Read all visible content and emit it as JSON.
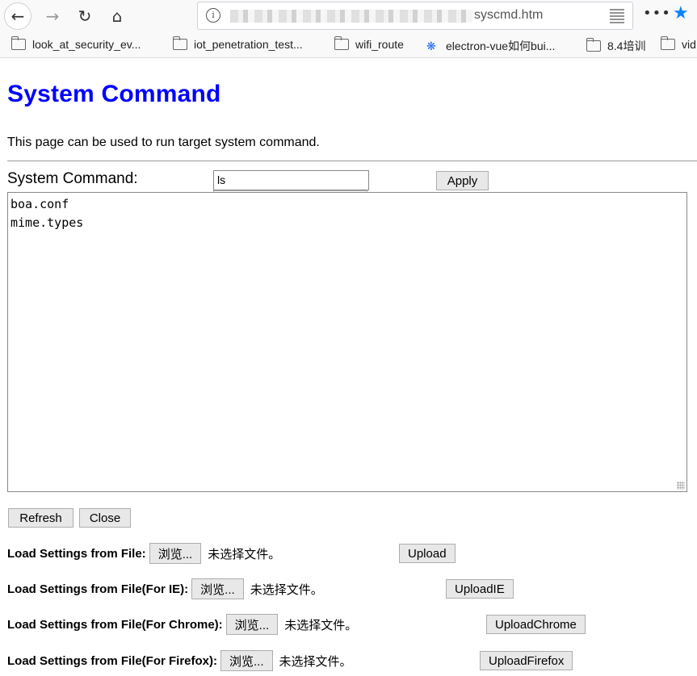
{
  "browser": {
    "url_suffix": "syscmd.htm",
    "bookmarks": [
      {
        "label": "look_at_security_ev...",
        "icon": "folder-icon"
      },
      {
        "label": "iot_penetration_test...",
        "icon": "folder-icon"
      },
      {
        "label": "wifi_route",
        "icon": "folder-icon"
      },
      {
        "label": "electron-vue如何bui...",
        "icon": "baidu-icon"
      },
      {
        "label": "8.4培训",
        "icon": "folder-icon"
      },
      {
        "label": "vid",
        "icon": "folder-icon"
      }
    ]
  },
  "page": {
    "title": "System Command",
    "description": "This page can be used to run target system command.",
    "command_label": "System Command:",
    "command_value": "ls",
    "autocomplete_suggestion": "ls",
    "apply_label": "Apply",
    "output_lines": "boa.conf\nmime.types",
    "refresh_label": "Refresh",
    "close_label": "Close",
    "upload_rows": [
      {
        "label": "Load Settings from File:",
        "browse": "浏览...",
        "status": "未选择文件。",
        "button": "Upload"
      },
      {
        "label": "Load Settings from File(For IE):",
        "browse": "浏览...",
        "status": "未选择文件。",
        "button": "UploadIE"
      },
      {
        "label": "Load Settings from File(For Chrome):",
        "browse": "浏览...",
        "status": "未选择文件。",
        "button": "UploadChrome"
      },
      {
        "label": "Load Settings from File(For Firefox):",
        "browse": "浏览...",
        "status": "未选择文件。",
        "button": "UploadFirefox"
      }
    ]
  },
  "colors": {
    "title": "#0000ff",
    "star": "#0a84ff"
  }
}
